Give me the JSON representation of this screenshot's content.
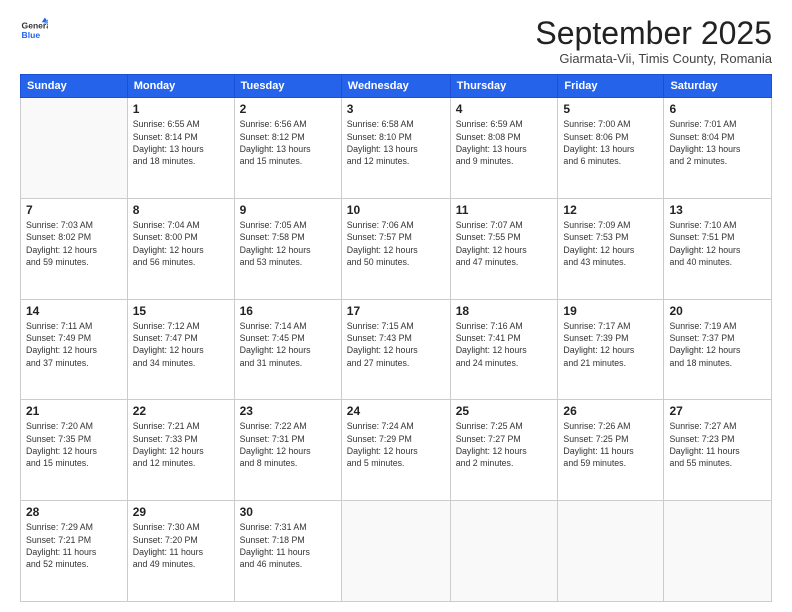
{
  "logo": {
    "general": "General",
    "blue": "Blue"
  },
  "header": {
    "month": "September 2025",
    "location": "Giarmata-Vii, Timis County, Romania"
  },
  "days_of_week": [
    "Sunday",
    "Monday",
    "Tuesday",
    "Wednesday",
    "Thursday",
    "Friday",
    "Saturday"
  ],
  "weeks": [
    [
      {
        "day": "",
        "info": ""
      },
      {
        "day": "1",
        "info": "Sunrise: 6:55 AM\nSunset: 8:14 PM\nDaylight: 13 hours\nand 18 minutes."
      },
      {
        "day": "2",
        "info": "Sunrise: 6:56 AM\nSunset: 8:12 PM\nDaylight: 13 hours\nand 15 minutes."
      },
      {
        "day": "3",
        "info": "Sunrise: 6:58 AM\nSunset: 8:10 PM\nDaylight: 13 hours\nand 12 minutes."
      },
      {
        "day": "4",
        "info": "Sunrise: 6:59 AM\nSunset: 8:08 PM\nDaylight: 13 hours\nand 9 minutes."
      },
      {
        "day": "5",
        "info": "Sunrise: 7:00 AM\nSunset: 8:06 PM\nDaylight: 13 hours\nand 6 minutes."
      },
      {
        "day": "6",
        "info": "Sunrise: 7:01 AM\nSunset: 8:04 PM\nDaylight: 13 hours\nand 2 minutes."
      }
    ],
    [
      {
        "day": "7",
        "info": "Sunrise: 7:03 AM\nSunset: 8:02 PM\nDaylight: 12 hours\nand 59 minutes."
      },
      {
        "day": "8",
        "info": "Sunrise: 7:04 AM\nSunset: 8:00 PM\nDaylight: 12 hours\nand 56 minutes."
      },
      {
        "day": "9",
        "info": "Sunrise: 7:05 AM\nSunset: 7:58 PM\nDaylight: 12 hours\nand 53 minutes."
      },
      {
        "day": "10",
        "info": "Sunrise: 7:06 AM\nSunset: 7:57 PM\nDaylight: 12 hours\nand 50 minutes."
      },
      {
        "day": "11",
        "info": "Sunrise: 7:07 AM\nSunset: 7:55 PM\nDaylight: 12 hours\nand 47 minutes."
      },
      {
        "day": "12",
        "info": "Sunrise: 7:09 AM\nSunset: 7:53 PM\nDaylight: 12 hours\nand 43 minutes."
      },
      {
        "day": "13",
        "info": "Sunrise: 7:10 AM\nSunset: 7:51 PM\nDaylight: 12 hours\nand 40 minutes."
      }
    ],
    [
      {
        "day": "14",
        "info": "Sunrise: 7:11 AM\nSunset: 7:49 PM\nDaylight: 12 hours\nand 37 minutes."
      },
      {
        "day": "15",
        "info": "Sunrise: 7:12 AM\nSunset: 7:47 PM\nDaylight: 12 hours\nand 34 minutes."
      },
      {
        "day": "16",
        "info": "Sunrise: 7:14 AM\nSunset: 7:45 PM\nDaylight: 12 hours\nand 31 minutes."
      },
      {
        "day": "17",
        "info": "Sunrise: 7:15 AM\nSunset: 7:43 PM\nDaylight: 12 hours\nand 27 minutes."
      },
      {
        "day": "18",
        "info": "Sunrise: 7:16 AM\nSunset: 7:41 PM\nDaylight: 12 hours\nand 24 minutes."
      },
      {
        "day": "19",
        "info": "Sunrise: 7:17 AM\nSunset: 7:39 PM\nDaylight: 12 hours\nand 21 minutes."
      },
      {
        "day": "20",
        "info": "Sunrise: 7:19 AM\nSunset: 7:37 PM\nDaylight: 12 hours\nand 18 minutes."
      }
    ],
    [
      {
        "day": "21",
        "info": "Sunrise: 7:20 AM\nSunset: 7:35 PM\nDaylight: 12 hours\nand 15 minutes."
      },
      {
        "day": "22",
        "info": "Sunrise: 7:21 AM\nSunset: 7:33 PM\nDaylight: 12 hours\nand 12 minutes."
      },
      {
        "day": "23",
        "info": "Sunrise: 7:22 AM\nSunset: 7:31 PM\nDaylight: 12 hours\nand 8 minutes."
      },
      {
        "day": "24",
        "info": "Sunrise: 7:24 AM\nSunset: 7:29 PM\nDaylight: 12 hours\nand 5 minutes."
      },
      {
        "day": "25",
        "info": "Sunrise: 7:25 AM\nSunset: 7:27 PM\nDaylight: 12 hours\nand 2 minutes."
      },
      {
        "day": "26",
        "info": "Sunrise: 7:26 AM\nSunset: 7:25 PM\nDaylight: 11 hours\nand 59 minutes."
      },
      {
        "day": "27",
        "info": "Sunrise: 7:27 AM\nSunset: 7:23 PM\nDaylight: 11 hours\nand 55 minutes."
      }
    ],
    [
      {
        "day": "28",
        "info": "Sunrise: 7:29 AM\nSunset: 7:21 PM\nDaylight: 11 hours\nand 52 minutes."
      },
      {
        "day": "29",
        "info": "Sunrise: 7:30 AM\nSunset: 7:20 PM\nDaylight: 11 hours\nand 49 minutes."
      },
      {
        "day": "30",
        "info": "Sunrise: 7:31 AM\nSunset: 7:18 PM\nDaylight: 11 hours\nand 46 minutes."
      },
      {
        "day": "",
        "info": ""
      },
      {
        "day": "",
        "info": ""
      },
      {
        "day": "",
        "info": ""
      },
      {
        "day": "",
        "info": ""
      }
    ]
  ]
}
